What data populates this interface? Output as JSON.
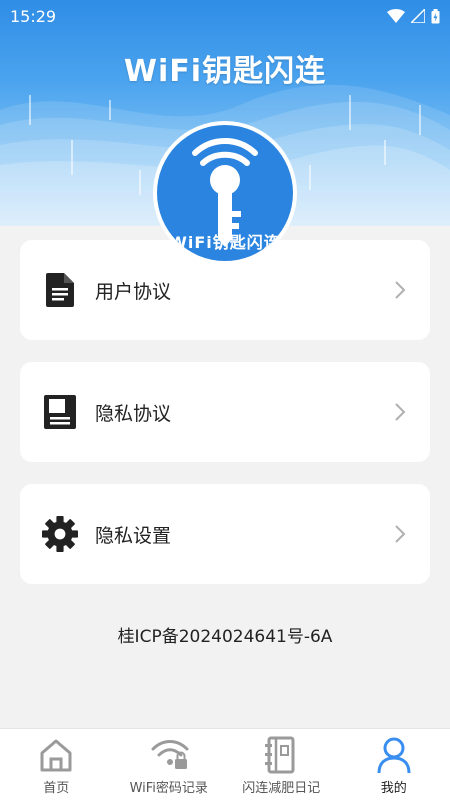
{
  "status_bar": {
    "time": "15:29",
    "icons": [
      "wifi-icon",
      "cellular-signal-icon",
      "battery-icon"
    ]
  },
  "header": {
    "title": "WiFi钥匙闪连",
    "logo_text": "WiFi钥匙闪连"
  },
  "menu": [
    {
      "label": "用户协议",
      "icon": "document-icon"
    },
    {
      "label": "隐私协议",
      "icon": "privacy-book-icon"
    },
    {
      "label": "隐私设置",
      "icon": "gear-icon"
    }
  ],
  "footer": {
    "icp": "桂ICP备2024024641号-6A"
  },
  "tabbar": {
    "tabs": [
      {
        "label": "首页",
        "icon": "home-icon",
        "active": false
      },
      {
        "label": "WiFi密码记录",
        "icon": "wifi-lock-icon",
        "active": false
      },
      {
        "label": "闪连减肥日记",
        "icon": "notebook-icon",
        "active": false
      },
      {
        "label": "我的",
        "icon": "user-icon",
        "active": true
      }
    ]
  },
  "colors": {
    "accent": "#2a84e0",
    "header_top": "#2f8de6",
    "active_tab": "#3a8ef0",
    "inactive_tab": "#9a9a9a"
  }
}
